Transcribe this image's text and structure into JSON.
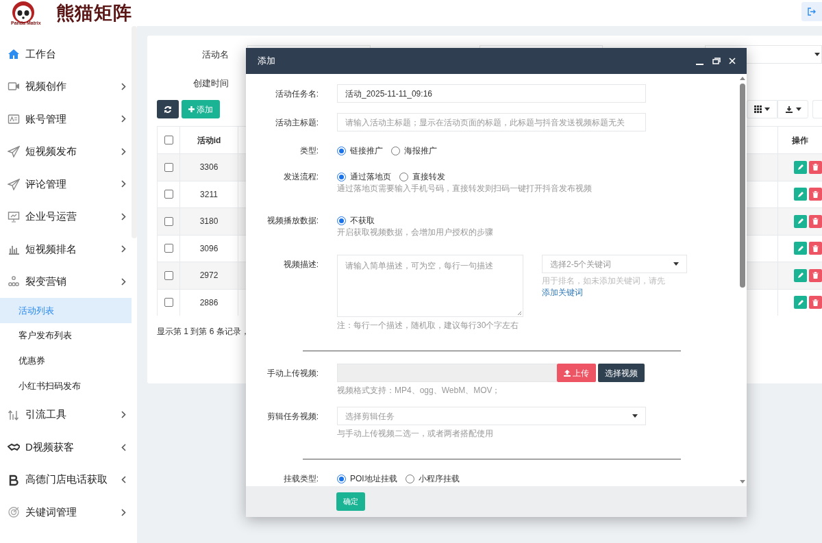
{
  "header": {
    "logo_text": "熊猫矩阵",
    "logo_subtext": "Panda Matrix"
  },
  "sidebar": {
    "items": [
      {
        "label": "工作台",
        "kind": "plain"
      },
      {
        "label": "视频创作",
        "kind": "menu"
      },
      {
        "label": "账号管理",
        "kind": "menu"
      },
      {
        "label": "短视频发布",
        "kind": "menu"
      },
      {
        "label": "评论管理",
        "kind": "menu"
      },
      {
        "label": "企业号运营",
        "kind": "menu"
      },
      {
        "label": "短视频排名",
        "kind": "menu"
      },
      {
        "label": "裂变营销",
        "kind": "menu",
        "children": [
          {
            "label": "活动列表",
            "selected": true
          },
          {
            "label": "客户发布列表",
            "selected": false
          },
          {
            "label": "优惠券",
            "selected": false
          },
          {
            "label": "小红书扫码发布",
            "selected": false
          }
        ]
      },
      {
        "label": "引流工具",
        "kind": "menu"
      },
      {
        "label": "D视频获客",
        "kind": "extra"
      },
      {
        "label": "高德门店电话获取",
        "kind": "extra"
      },
      {
        "label": "关键词管理",
        "kind": "menu"
      }
    ]
  },
  "search": {
    "fields": [
      {
        "label": "活动名"
      },
      {
        "label": "创建时间"
      }
    ]
  },
  "toolbar": {
    "add_button": "添加"
  },
  "table": {
    "all_checked": false,
    "columns": [
      {
        "label": "活动id"
      },
      {
        "label": "操作"
      }
    ],
    "rows": [
      {
        "id": "3306",
        "checked": false
      },
      {
        "id": "3211",
        "checked": false
      },
      {
        "id": "3180",
        "checked": false
      },
      {
        "id": "3096",
        "checked": false
      },
      {
        "id": "2972",
        "checked": false
      },
      {
        "id": "2886",
        "checked": false
      }
    ]
  },
  "pagination": "显示第 1 到第 6 条记录，",
  "dialog": {
    "title": "添加",
    "submit": "确定",
    "fields": [
      {
        "kind": "text",
        "label": "活动任务名:",
        "value": "活动_2025-11-11_09:16"
      },
      {
        "kind": "text",
        "label": "活动主标题:",
        "placeholder": "请输入活动主标题；显示在活动页面的标题，此标题与抖音发送视频标题无关"
      },
      {
        "kind": "radio",
        "label": "类型:",
        "options": [
          {
            "label": "链接推广",
            "selected": true
          },
          {
            "label": "海报推广",
            "selected": false
          }
        ]
      },
      {
        "kind": "radio",
        "label": "发送流程:",
        "options": [
          {
            "label": "通过落地页",
            "selected": true
          },
          {
            "label": "直接转发",
            "selected": false
          }
        ],
        "help": "通过落地页需要输入手机号码，直接转发则扫码一键打开抖音发布视频"
      },
      {
        "kind": "radio",
        "label": "视频播放数据:",
        "options": [
          {
            "label": "不获取",
            "selected": true
          }
        ],
        "help": "开启获取视频数据，会增加用户授权的步骤"
      },
      {
        "kind": "textarea",
        "label": "视频描述:",
        "placeholder": "请输入简单描述，可为空，每行一句描述",
        "help": "注：每行一个描述，随机取，建议每行30个字左右",
        "side_select": "选择2-5个关键词",
        "side_help": "用于排名，如未添加关键词，请先",
        "side_link": "添加关键词"
      },
      {
        "kind": "divider"
      },
      {
        "kind": "upload",
        "label": "手动上传视频:",
        "upload_button": "上传",
        "choose_button": "选择视频",
        "help": "视频格式支持：MP4、ogg、WebM、MOV；"
      },
      {
        "kind": "select",
        "label": "剪辑任务视频:",
        "placeholder": "选择剪辑任务",
        "help": "与手动上传视频二选一，或者两者搭配使用"
      },
      {
        "kind": "divider"
      },
      {
        "kind": "radio",
        "label": "挂载类型:",
        "options": [
          {
            "label": "POI地址挂载",
            "selected": true
          },
          {
            "label": "小程序挂载",
            "selected": false
          }
        ]
      }
    ]
  }
}
